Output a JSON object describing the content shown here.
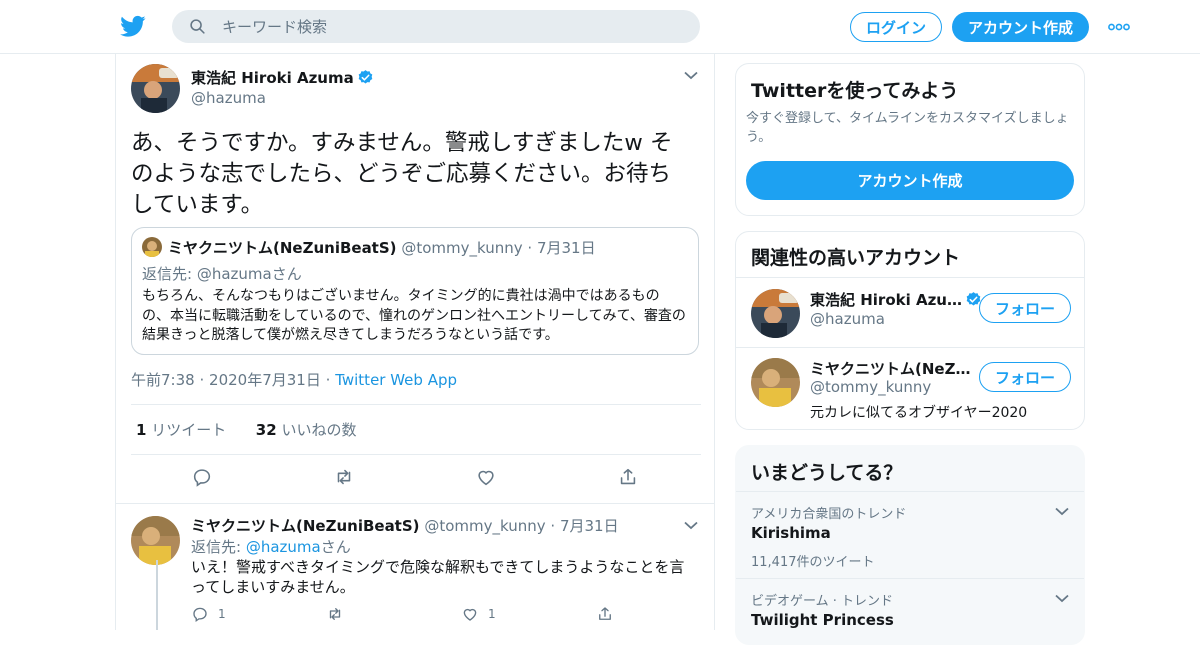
{
  "header": {
    "search_placeholder": "キーワード検索",
    "login_label": "ログイン",
    "signup_label": "アカウント作成",
    "logo_icon": "twitter-bird-icon",
    "more_icon": "more-dots-icon"
  },
  "tweet": {
    "author_name": "東浩紀 Hiroki Azuma",
    "author_handle": "@hazuma",
    "text": "あ、そうですか。すみません。警戒しすぎましたw そのような志でしたら、どうぞご応募ください。お待ちしています。",
    "quote": {
      "author_name": "ミヤクニツトム(NeZuniBeatS)",
      "author_handle": "@tommy_kunny",
      "date": "7月31日",
      "reply_prefix": "返信先: ",
      "reply_handle": "@hazuma",
      "reply_suffix": "さん",
      "text": "もちろん、そんなつもりはございません。タイミング的に貴社は渦中ではあるものの、本当に転職活動をしているので、憧れのゲンロン社へエントリーしてみて、審査の結果きっと脱落して僕が燃え尽きてしまうだろうなという話です。"
    },
    "time": "午前7:38",
    "date": "2020年7月31日",
    "source": "Twitter Web App",
    "retweet_count": "1",
    "retweet_label": "リツイート",
    "like_count": "32",
    "like_label": "いいねの数"
  },
  "reply": {
    "author_name": "ミヤクニツトム(NeZuniBeatS)",
    "author_handle": "@tommy_kunny",
    "date": "7月31日",
    "reply_prefix": "返信先: ",
    "reply_handle": "@hazuma",
    "reply_suffix": "さん",
    "text": "いえ！警戒すべきタイミングで危険な解釈もできてしまうようなことを言ってしまいすみません。",
    "reply_count": "1",
    "like_count": "1"
  },
  "signup_card": {
    "title": "Twitterを使ってみよう",
    "subtitle": "今すぐ登録して、タイムラインをカスタマイズしましょう。",
    "button_label": "アカウント作成"
  },
  "related": {
    "title": "関連性の高いアカウント",
    "accounts": [
      {
        "name": "東浩紀 Hiroki Azu…",
        "handle": "@hazuma",
        "bio": "",
        "follow_label": "フォロー"
      },
      {
        "name": "ミヤクニツトム(NeZ…",
        "handle": "@tommy_kunny",
        "bio": "元カレに似てるオブザイヤー2020",
        "follow_label": "フォロー"
      }
    ]
  },
  "trends": {
    "title": "いまどうしてる？",
    "items": [
      {
        "category": "アメリカ合衆国のトレンド",
        "name": "Kirishima",
        "count": "11,417件のツイート"
      },
      {
        "category": "ビデオゲーム · トレンド",
        "name": "Twilight Princess",
        "count": ""
      }
    ]
  },
  "colors": {
    "accent": "#1da1f2",
    "link": "#1b95e0",
    "muted": "#657786",
    "verified": "#1da1f2"
  }
}
